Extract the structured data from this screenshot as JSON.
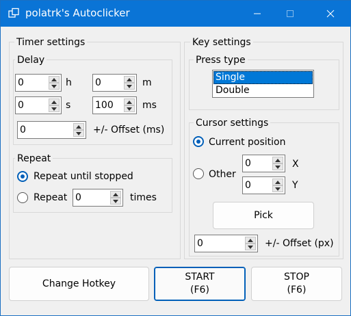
{
  "window": {
    "title": "polatrk's Autoclicker",
    "titlebar_color": "#0a74d6",
    "controls": {
      "minimize": "minimize-icon",
      "maximize": "maximize-icon",
      "close": "close-icon"
    }
  },
  "timer": {
    "title": "Timer settings",
    "delay": {
      "title": "Delay",
      "hours": {
        "value": "0",
        "unit": "h"
      },
      "minutes": {
        "value": "0",
        "unit": "m"
      },
      "seconds": {
        "value": "0",
        "unit": "s"
      },
      "milliseconds": {
        "value": "100",
        "unit": "ms"
      },
      "offset": {
        "value": "0",
        "label": "+/- Offset (ms)"
      }
    },
    "repeat": {
      "title": "Repeat",
      "until_stopped_label": "Repeat until stopped",
      "count_label": "Repeat",
      "count_value": "0",
      "times_label": "times",
      "selected": "until_stopped"
    }
  },
  "keys": {
    "title": "Key settings",
    "press_type": {
      "title": "Press type",
      "options": [
        "Single",
        "Double"
      ],
      "selected": "Single"
    }
  },
  "cursor": {
    "title": "Cursor settings",
    "current_label": "Current position",
    "other_label": "Other",
    "x_value": "0",
    "x_label": "X",
    "y_value": "0",
    "y_label": "Y",
    "pick_label": "Pick",
    "offset_value": "0",
    "offset_label": "+/- Offset (px)",
    "selected": "current"
  },
  "buttons": {
    "hotkey": "Change Hotkey",
    "start": "START",
    "start_key": "(F6)",
    "stop": "STOP",
    "stop_key": "(F6)"
  },
  "colors": {
    "accent": "#005fb8",
    "selection": "#0078d7"
  }
}
